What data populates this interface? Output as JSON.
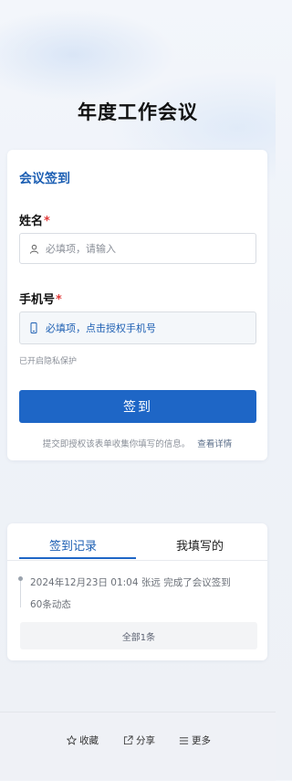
{
  "page": {
    "title": "年度工作会议"
  },
  "form": {
    "heading": "会议签到",
    "name_field": {
      "label": "姓名",
      "required_mark": "*",
      "placeholder": "必填项，请输入",
      "icon": "user-icon"
    },
    "phone_field": {
      "label": "手机号",
      "required_mark": "*",
      "placeholder": "必填项，点击授权手机号",
      "icon": "phone-icon"
    },
    "privacy_note": "已开启隐私保护",
    "submit_label": "签到",
    "consent_text": "提交即授权该表单收集你填写的信息。",
    "consent_link": "查看详情"
  },
  "records": {
    "tabs": [
      {
        "label": "签到记录",
        "active": true
      },
      {
        "label": "我填写的",
        "active": false
      }
    ],
    "items": [
      {
        "text": "2024年12月23日 01:04  张远  完成了会议签到"
      }
    ],
    "dynamic_count": "60条动态",
    "all_button": "全部1条"
  },
  "bottom_bar": {
    "actions": [
      {
        "label": "收藏",
        "icon": "star-icon"
      },
      {
        "label": "分享",
        "icon": "share-icon"
      },
      {
        "label": "更多",
        "icon": "menu-icon"
      }
    ]
  },
  "colors": {
    "accent": "#1e66c6",
    "heading": "#1d5fb3",
    "required": "#e03a3a"
  }
}
